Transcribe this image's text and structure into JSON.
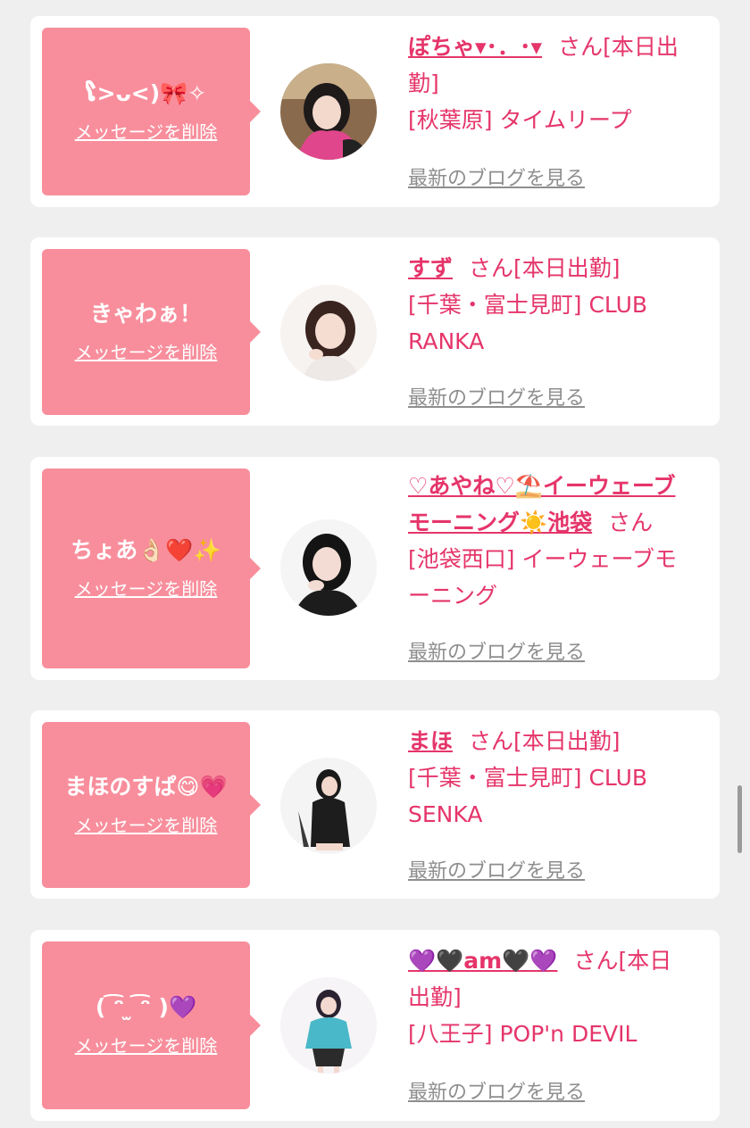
{
  "colors": {
    "accent": "#e5356a",
    "bubble": "#f88e9c",
    "muted": "#8e8e8e",
    "background": "#efefef"
  },
  "cards": [
    {
      "message": "ໂ>ᴗ<)🎀✧",
      "delete_label": "メッセージを削除",
      "avatar": "girl-photo-1",
      "name": "ぽちゃ▾･．･▾",
      "name_suffix": "さん[本日出",
      "line2": "勤]",
      "line3": "[秋葉原] タイムリープ",
      "line4": "",
      "blog_label": "最新のブログを見る"
    },
    {
      "message": "きゃわぁ！",
      "delete_label": "メッセージを削除",
      "avatar": "girl-photo-2",
      "name": "すず",
      "name_suffix": "さん[本日出勤]",
      "line2": "[千葉・富士見町] CLUB",
      "line3": "RANKA",
      "line4": "",
      "blog_label": "最新のブログを見る"
    },
    {
      "message": "ちょあ👌🏻❤️✨",
      "delete_label": "メッセージを削除",
      "avatar": "girl-photo-3",
      "name": "♡あやね♡⛱️イーウェーブ",
      "name_suffix": "",
      "line2_name": "モーニング☀️池袋",
      "line2_suffix": "さん",
      "line3": "[池袋西口] イーウェーブモ",
      "line4": "ーニング",
      "blog_label": "最新のブログを見る"
    },
    {
      "message": "まほのすぱ😋💗",
      "delete_label": "メッセージを削除",
      "avatar": "girl-photo-4",
      "name": "まほ",
      "name_suffix": "さん[本日出勤]",
      "line2": "[千葉・富士見町] CLUB",
      "line3": "SENKA",
      "line4": "",
      "blog_label": "最新のブログを見る"
    },
    {
      "message": "( ͡ᵔ ̫ ͡ᵔ )💜",
      "delete_label": "メッセージを削除",
      "avatar": "girl-photo-5",
      "name": "💜🖤am🖤💜",
      "name_suffix": "さん[本日",
      "line2": "出勤]",
      "line3": "[八王子] POP'n DEVIL",
      "line4": "",
      "blog_label": "最新のブログを見る"
    }
  ]
}
